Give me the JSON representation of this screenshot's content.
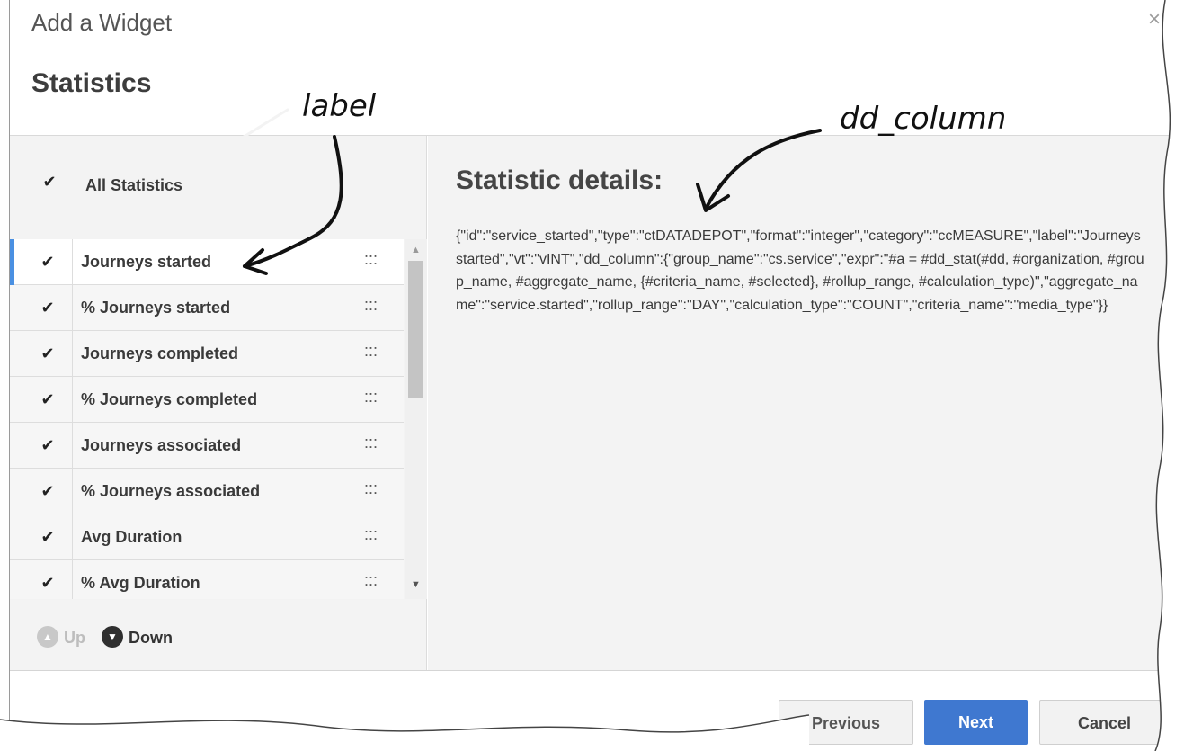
{
  "dialog": {
    "title": "Add a Widget",
    "close_glyph": "×",
    "section_title": "Statistics"
  },
  "left": {
    "all_label": "All Statistics",
    "all_checked": true,
    "items": [
      {
        "label": "Journeys started",
        "checked": true,
        "selected": true
      },
      {
        "label": "% Journeys started",
        "checked": true,
        "selected": false
      },
      {
        "label": "Journeys completed",
        "checked": true,
        "selected": false
      },
      {
        "label": "% Journeys completed",
        "checked": true,
        "selected": false
      },
      {
        "label": "Journeys associated",
        "checked": true,
        "selected": false
      },
      {
        "label": "% Journeys associated",
        "checked": true,
        "selected": false
      },
      {
        "label": "Avg Duration",
        "checked": true,
        "selected": false
      },
      {
        "label": "% Avg Duration",
        "checked": true,
        "selected": false
      }
    ],
    "check_glyph": "✔",
    "drag_glyph": ":::",
    "up_label": "Up",
    "down_label": "Down"
  },
  "right": {
    "details_title": "Statistic details:",
    "details_text": "{\"id\":\"service_started\",\"type\":\"ctDATADEPOT\",\"format\":\"integer\",\"category\":\"ccMEASURE\",\"label\":\"Journeys started\",\"vt\":\"vINT\",\"dd_column\":{\"group_name\":\"cs.service\",\"expr\":\"#a = #dd_stat(#dd, #organization, #group_name, #aggregate_name, {#criteria_name, #selected}, #rollup_range, #calculation_type)\",\"aggregate_name\":\"service.started\",\"rollup_range\":\"DAY\",\"calculation_type\":\"COUNT\",\"criteria_name\":\"media_type\"}}"
  },
  "footer": {
    "previous_label": "Previous",
    "next_label": "Next",
    "cancel_label": "Cancel"
  },
  "annotations": {
    "label_note": "label",
    "dd_column_note": "dd_column"
  },
  "colors": {
    "accent": "#3f78d0",
    "selected_bar": "#4a90e2",
    "panel_bg": "#f3f3f3"
  }
}
